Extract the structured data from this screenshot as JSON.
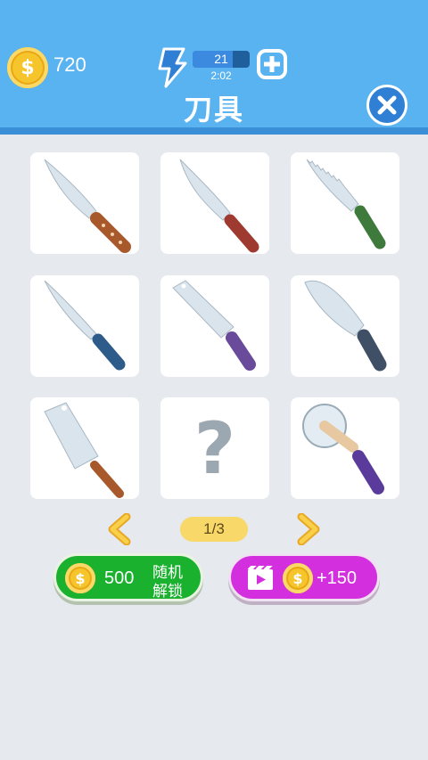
{
  "header": {
    "coins": "720",
    "energy": {
      "current": "21",
      "timer": "2:02",
      "fill": 0.7
    },
    "title": "刀具"
  },
  "icons": {
    "coin": "coin-icon",
    "lightning": "lightning-icon",
    "plus": "add-energy-icon",
    "close": "close-icon",
    "video": "video-ad-icon",
    "arrow_left": "chevron-left-icon",
    "arrow_right": "chevron-right-icon"
  },
  "grid": {
    "items": [
      {
        "name": "chef-knife-brown",
        "handle_color": "#a8592b",
        "locked": false
      },
      {
        "name": "chef-knife-red",
        "handle_color": "#9e3a30",
        "locked": false
      },
      {
        "name": "serrated-knife-green",
        "handle_color": "#3e7a3b",
        "locked": false
      },
      {
        "name": "boning-knife-blue",
        "handle_color": "#2d5b8a",
        "locked": false
      },
      {
        "name": "nakiri-knife-purple",
        "handle_color": "#6a4a9a",
        "locked": false
      },
      {
        "name": "santoku-knife-gray",
        "handle_color": "#3f5066",
        "locked": false
      },
      {
        "name": "cleaver-brown",
        "handle_color": "#a8592b",
        "locked": false
      },
      {
        "name": "locked-item",
        "symbol": "?",
        "locked": true
      },
      {
        "name": "pizza-cutter-purple",
        "handle_color": "#5a3a9a",
        "locked": false
      }
    ]
  },
  "pagination": {
    "label": "1/3"
  },
  "buttons": {
    "random_unlock": {
      "price": "500",
      "label_line1": "随机",
      "label_line2": "解锁"
    },
    "watch_ad": {
      "reward": "+150"
    }
  },
  "colors": {
    "header_bg": "#5ab3f1",
    "green_button": "#1ab12f",
    "purple_button": "#d42fdf",
    "coin": "#f6c42b"
  }
}
